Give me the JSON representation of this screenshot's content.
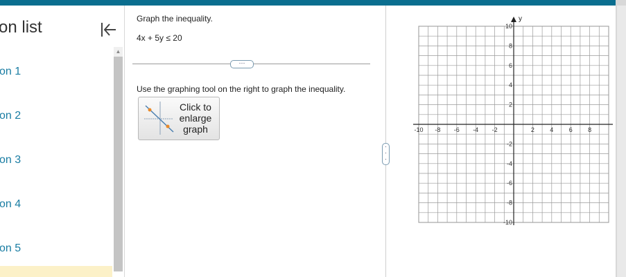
{
  "sidebar": {
    "title": "on list",
    "items": [
      {
        "label": "on 1"
      },
      {
        "label": "on 2"
      },
      {
        "label": "on 3"
      },
      {
        "label": "on 4"
      },
      {
        "label": "on 5"
      }
    ]
  },
  "question": {
    "instruction": "Graph the inequality.",
    "inequality": "4x + 5y ≤ 20",
    "more_label": "⋯",
    "tool_hint": "Use the graphing tool on the right to graph the inequality.",
    "enlarge": {
      "line1": "Click to",
      "line2": "enlarge",
      "line3": "graph"
    }
  },
  "graph": {
    "x_axis_label": "",
    "y_axis_label": "y",
    "x_range": [
      -10,
      10
    ],
    "y_range": [
      -10,
      10
    ],
    "x_ticks": [
      "-10",
      "-8",
      "-6",
      "-4",
      "-2",
      "2",
      "4",
      "6",
      "8"
    ],
    "y_ticks": [
      "10",
      "8",
      "6",
      "4",
      "2",
      "-2",
      "-4",
      "-6",
      "-8",
      "-10"
    ]
  },
  "colors": {
    "accent": "#0a6e8f",
    "link": "#1a7da3",
    "highlight": "#fcf1c8"
  }
}
